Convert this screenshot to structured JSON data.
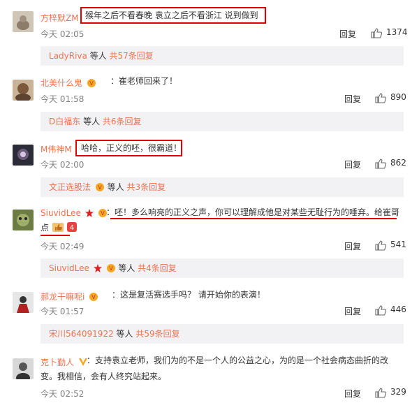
{
  "reply_label": "回复",
  "comments": [
    {
      "user": "方梓默ZM",
      "text": "猴年之后不看春晚 袁立之后不看浙江  说到做到",
      "time": "今天 02:05",
      "likes": "1374",
      "sub": {
        "user": "LadyRiva",
        "mid": " 等人 ",
        "count": "共57条回复"
      }
    },
    {
      "user": "北美什么鬼",
      "text": "：崔老师回来了！",
      "time": "今天 01:58",
      "likes": "890",
      "sub": {
        "user": "D白福东",
        "mid": " 等人 ",
        "count": "共6条回复"
      }
    },
    {
      "user": "M伟神M",
      "text": "哈哈，正义的呸，很霸道！",
      "time": "今天 02:00",
      "likes": "862",
      "sub": {
        "user": "文正选股法",
        "mid": " 等人 ",
        "count": "共3条回复"
      }
    },
    {
      "user": "SiuvidLee",
      "text_line1": "：呸！多么响亮的正义之声，你可以理解成他是对某些无耻行为的唾弃。给崔哥",
      "text_line2": "点",
      "time": "今天 02:49",
      "likes": "541",
      "sub": {
        "user": "SiuvidLee",
        "mid": " 等人 ",
        "count": "共4条回复"
      }
    },
    {
      "user": "郝龙干嘛呢i",
      "text": "：这是复活赛选手吗？ 请开始你的表演！",
      "time": "今天 01:57",
      "likes": "446",
      "sub": {
        "user": "宋川564091922",
        "mid": " 等人 ",
        "count": "共59条回复"
      }
    },
    {
      "user": "克卜勤人",
      "text_line1": "：支持袁立老师，我们为的不是一个人的公益之心，为的是一个社会病态曲折的改",
      "text_line2": "变。我相信，会有人终究站起来。",
      "time": "今天 02:52",
      "likes": "329"
    }
  ]
}
